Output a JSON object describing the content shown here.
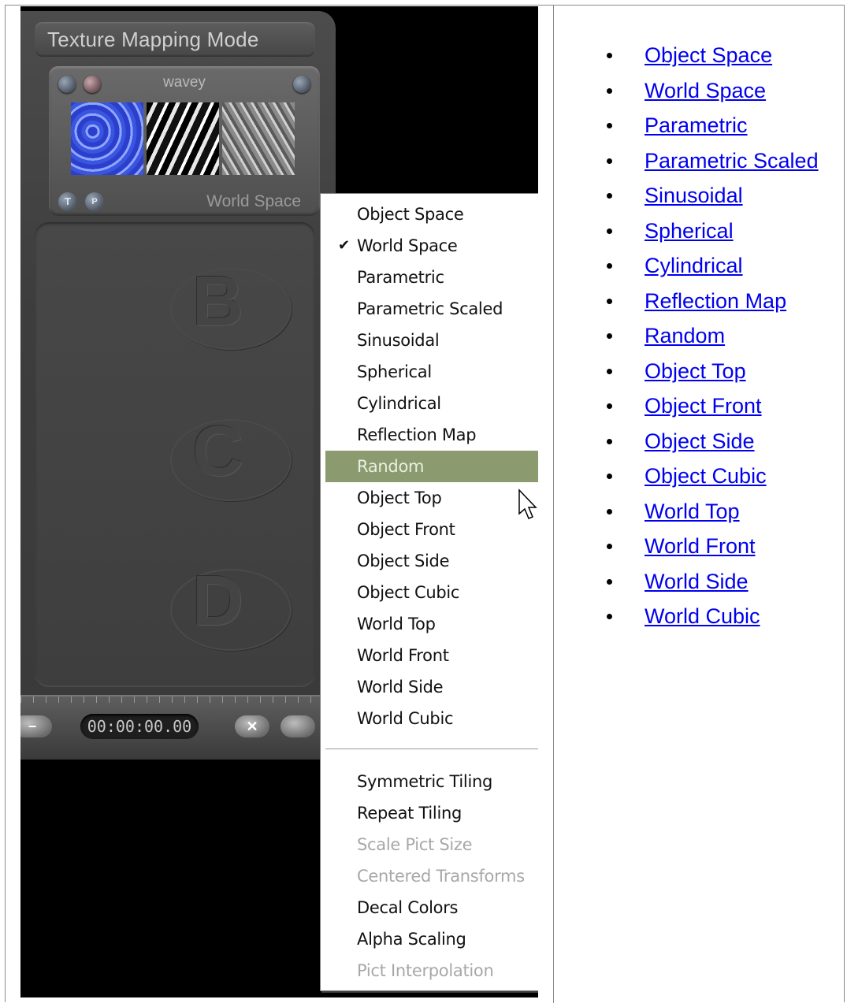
{
  "panel": {
    "title": "Texture Mapping Mode",
    "texture_name": "wavey",
    "current_mode": "World Space",
    "btn_t": "T",
    "btn_p": "P",
    "slot_letters": [
      "B",
      "C",
      "D"
    ],
    "time": "00:00:00.00",
    "btn_minus": "−",
    "btn_x": "✕"
  },
  "menu": {
    "checked_item": "World Space",
    "highlighted_item": "Random",
    "mapping_items": [
      "Object Space",
      "World Space",
      "Parametric",
      "Parametric Scaled",
      "Sinusoidal",
      "Spherical",
      "Cylindrical",
      "Reflection Map",
      "Random",
      "Object Top",
      "Object Front",
      "Object Side",
      "Object Cubic",
      "World Top",
      "World Front",
      "World Side",
      "World Cubic"
    ],
    "option_items": [
      {
        "label": "Symmetric Tiling",
        "disabled": false
      },
      {
        "label": "Repeat Tiling",
        "disabled": false
      },
      {
        "label": "Scale Pict Size",
        "disabled": true
      },
      {
        "label": "Centered Transforms",
        "disabled": true
      },
      {
        "label": "Decal Colors",
        "disabled": false
      },
      {
        "label": "Alpha Scaling",
        "disabled": false
      },
      {
        "label": "Pict Interpolation",
        "disabled": true
      }
    ],
    "highlight_color": "#8c9b6f"
  },
  "links": [
    "Object Space",
    "World Space",
    "Parametric",
    "Parametric Scaled",
    "Sinusoidal",
    "Spherical",
    "Cylindrical",
    "Reflection Map",
    "Random",
    "Object Top",
    "Object Front",
    "Object Side",
    "Object Cubic",
    "World Top",
    "World Front",
    "World Side",
    "World Cubic"
  ],
  "link_color": "#0000ee"
}
